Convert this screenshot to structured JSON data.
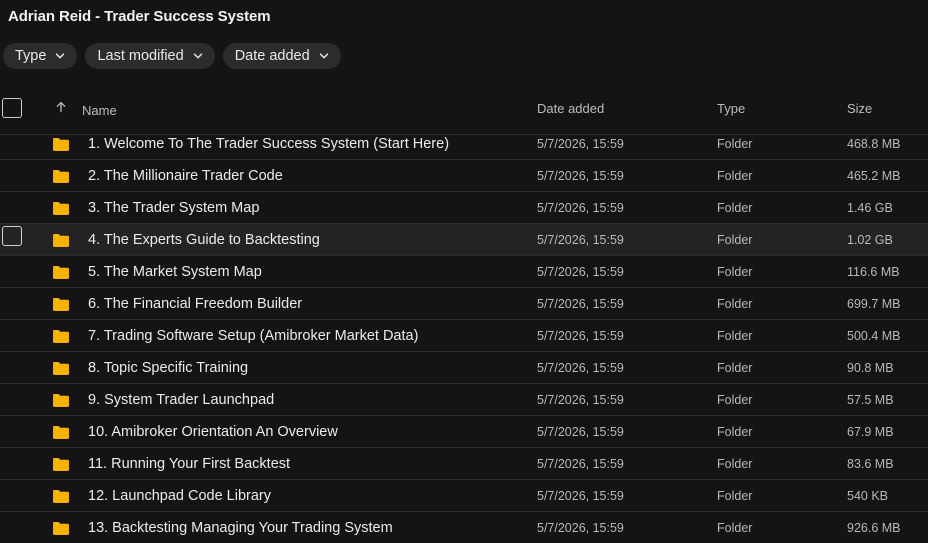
{
  "title": "Adrian Reid - Trader Success System",
  "filters": [
    {
      "label": "Type"
    },
    {
      "label": "Last modified"
    },
    {
      "label": "Date added"
    }
  ],
  "columns": {
    "name": "Name",
    "date_added": "Date added",
    "type": "Type",
    "size": "Size"
  },
  "colors": {
    "background": "#141414",
    "folder": "#f5b300",
    "chip": "#2c2c2c"
  },
  "rows": [
    {
      "name": "1. Welcome To The Trader Success System (Start Here)",
      "date": "5/7/2026, 15:59",
      "type": "Folder",
      "size": "468.8 MB"
    },
    {
      "name": "2. The Millionaire Trader Code",
      "date": "5/7/2026, 15:59",
      "type": "Folder",
      "size": "465.2 MB"
    },
    {
      "name": "3. The Trader System Map",
      "date": "5/7/2026, 15:59",
      "type": "Folder",
      "size": "1.46 GB"
    },
    {
      "name": "4. The Experts Guide to Backtesting",
      "date": "5/7/2026, 15:59",
      "type": "Folder",
      "size": "1.02 GB"
    },
    {
      "name": "5. The Market System Map",
      "date": "5/7/2026, 15:59",
      "type": "Folder",
      "size": "116.6 MB"
    },
    {
      "name": "6. The Financial Freedom Builder",
      "date": "5/7/2026, 15:59",
      "type": "Folder",
      "size": "699.7 MB"
    },
    {
      "name": "7. Trading Software Setup (Amibroker Market Data)",
      "date": "5/7/2026, 15:59",
      "type": "Folder",
      "size": "500.4 MB"
    },
    {
      "name": "8. Topic Specific Training",
      "date": "5/7/2026, 15:59",
      "type": "Folder",
      "size": "90.8 MB"
    },
    {
      "name": "9. System Trader Launchpad",
      "date": "5/7/2026, 15:59",
      "type": "Folder",
      "size": "57.5 MB"
    },
    {
      "name": "10. Amibroker Orientation An Overview",
      "date": "5/7/2026, 15:59",
      "type": "Folder",
      "size": "67.9 MB"
    },
    {
      "name": "11. Running Your First Backtest",
      "date": "5/7/2026, 15:59",
      "type": "Folder",
      "size": "83.6 MB"
    },
    {
      "name": "12. Launchpad Code Library",
      "date": "5/7/2026, 15:59",
      "type": "Folder",
      "size": "540 KB"
    },
    {
      "name": "13. Backtesting Managing Your Trading System",
      "date": "5/7/2026, 15:59",
      "type": "Folder",
      "size": "926.6 MB"
    }
  ]
}
